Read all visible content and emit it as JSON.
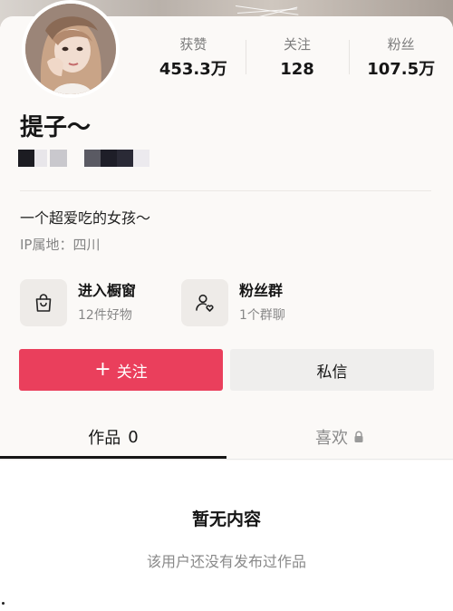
{
  "profile": {
    "name": "提子～",
    "bio": "一个超爱吃的女孩～",
    "ip_location": "IP属地：四川"
  },
  "stats": [
    {
      "label": "获赞",
      "value": "453.3万"
    },
    {
      "label": "关注",
      "value": "128"
    },
    {
      "label": "粉丝",
      "value": "107.5万"
    }
  ],
  "features": {
    "showcase": {
      "title": "进入橱窗",
      "subtitle": "12件好物",
      "icon": "shopping-bag-icon"
    },
    "fan_group": {
      "title": "粉丝群",
      "subtitle": "1个群聊",
      "icon": "user-heart-icon"
    }
  },
  "actions": {
    "follow_plus": "+",
    "follow_label": "关注",
    "message_label": "私信"
  },
  "tabs": {
    "works_label": "作品",
    "works_count": "0",
    "likes_label": "喜欢",
    "likes_icon": "lock-icon"
  },
  "empty_state": {
    "title": "暂无内容",
    "subtitle": "该用户还没有发布过作品"
  },
  "colors": {
    "follow_button": "#ea3f5c",
    "message_button": "#efeeed",
    "background": "#fbf9f7"
  }
}
